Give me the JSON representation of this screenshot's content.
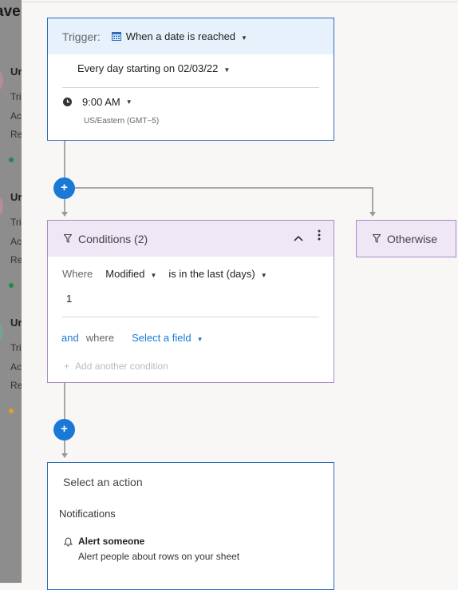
{
  "background_panel": {
    "title": "ave",
    "sections": [
      {
        "heading": "Ur",
        "lines": [
          "Tri",
          "Ac",
          "Re"
        ],
        "status_color": "#1f8a4c"
      },
      {
        "heading": "Ur",
        "lines": [
          "Tri",
          "Ac",
          "Re"
        ],
        "status_color": "#1f8a4c"
      },
      {
        "heading": "Ur",
        "lines": [
          "Tri",
          "Ac",
          "Re"
        ],
        "status_color": "#e0a21d"
      }
    ]
  },
  "trigger": {
    "label": "Trigger:",
    "type": "When a date is reached",
    "schedule": "Every day starting on 02/03/22",
    "time": "9:00 AM",
    "timezone": "US/Eastern (GMT−5)"
  },
  "conditions": {
    "title": "Conditions (2)",
    "where_label": "Where",
    "field": "Modified",
    "operator": "is in the last (days)",
    "value": "1",
    "and_label": "and",
    "and_where_label": "where",
    "select_field": "Select a field",
    "add_condition": "Add another condition"
  },
  "otherwise": {
    "label": "Otherwise"
  },
  "action": {
    "title": "Select an action",
    "category": "Notifications",
    "option_title": "Alert someone",
    "option_desc": "Alert people about rows on your sheet"
  },
  "add_symbol": "+",
  "colors": {
    "accent": "#1a79d6",
    "trigger_border": "#2c6bbf",
    "trigger_header": "#e6f1fb",
    "condition_border": "#a98cc6",
    "condition_header": "#efe6f6"
  }
}
